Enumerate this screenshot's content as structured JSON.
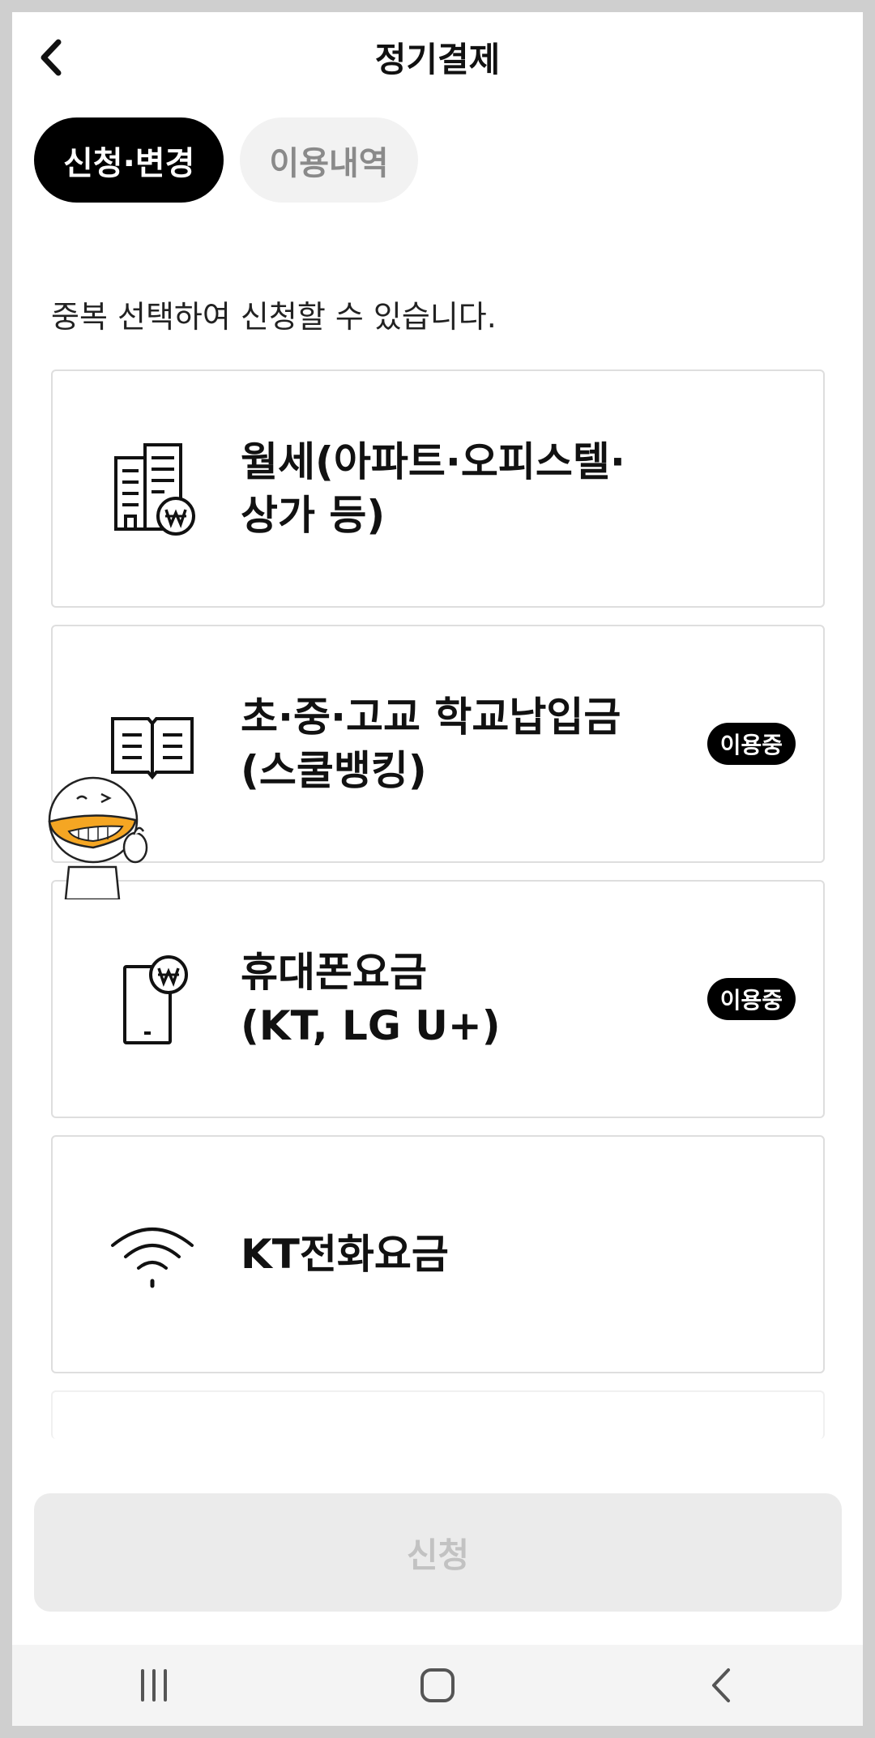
{
  "header": {
    "title": "정기결제",
    "back_icon": "chevron-left-icon"
  },
  "tabs": [
    {
      "label": "신청·변경",
      "active": true
    },
    {
      "label": "이용내역",
      "active": false
    }
  ],
  "subtitle": "중복 선택하여 신청할 수 있습니다.",
  "cards": [
    {
      "icon": "building-won-icon",
      "line1": "월세(아파트·오피스텔·",
      "line2": "상가 등)",
      "badge": ""
    },
    {
      "icon": "open-book-icon",
      "line1": "초·중·고교 학교납입금",
      "line2": "(스쿨뱅킹)",
      "badge": "이용중"
    },
    {
      "icon": "phone-won-icon",
      "line1": "휴대폰요금",
      "line2": "(KT, LG U+)",
      "badge": "이용중"
    },
    {
      "icon": "wifi-icon",
      "line1": "KT전화요금",
      "line2": "",
      "badge": ""
    }
  ],
  "apply_button": {
    "label": "신청"
  },
  "colors": {
    "accent": "#000000",
    "badge_bg": "#000000",
    "disabled_bg": "#ebebeb",
    "disabled_text": "#c2c2c2",
    "mascot_beak": "#f5a623"
  },
  "system_nav": [
    "recent-apps-icon",
    "home-icon",
    "back-icon"
  ]
}
